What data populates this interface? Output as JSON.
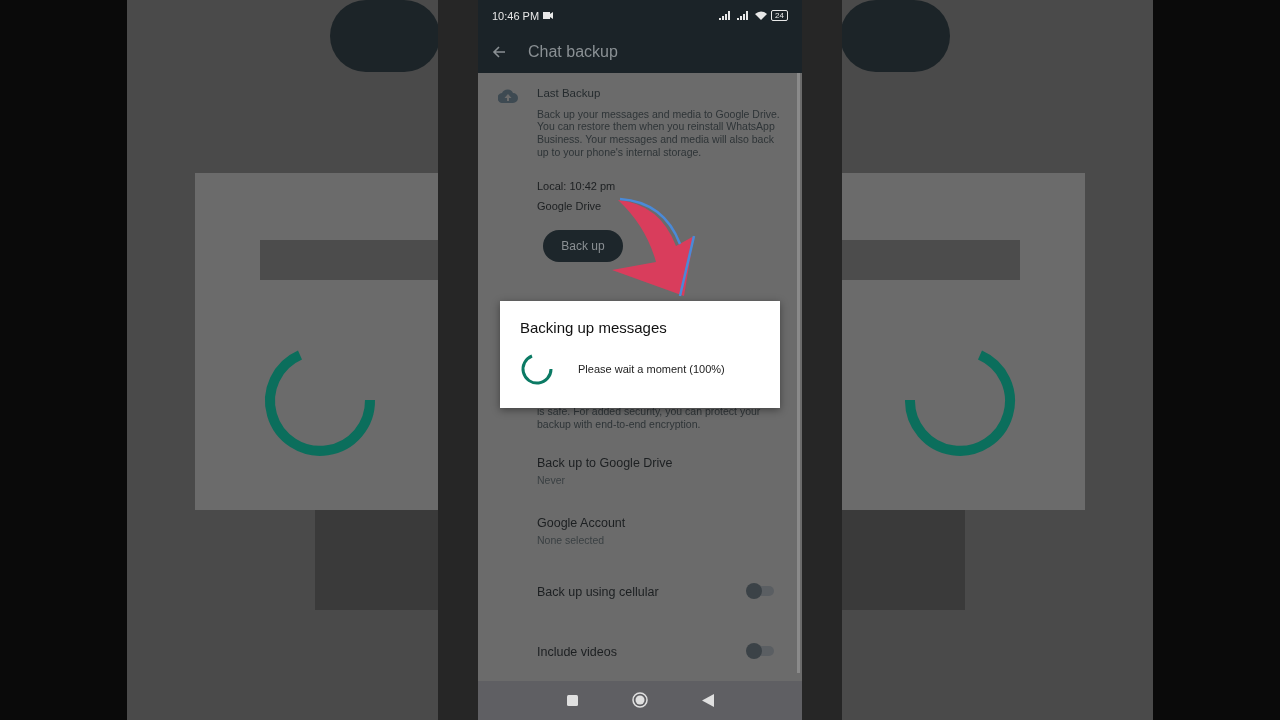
{
  "status_bar": {
    "time": "10:46 PM",
    "battery": "24"
  },
  "app_bar": {
    "title": "Chat backup"
  },
  "last_backup": {
    "title": "Last Backup",
    "description": "Back up your messages and media to Google Drive. You can restore them when you reinstall WhatsApp Business. Your messages and media will also back up to your phone's internal storage.",
    "local": "Local: 10:42 pm",
    "google_drive": "Google Drive",
    "button": "Back up"
  },
  "encryption": {
    "description": "is safe. For added security, you can protect your backup with end-to-end encryption."
  },
  "settings": [
    {
      "kind": "value",
      "title": "Back up to Google Drive",
      "value": "Never"
    },
    {
      "kind": "value",
      "title": "Google Account",
      "value": "None selected"
    },
    {
      "kind": "toggle",
      "title": "Back up using cellular",
      "on": false
    },
    {
      "kind": "toggle",
      "title": "Include videos",
      "on": false
    }
  ],
  "dialog": {
    "title": "Backing up messages",
    "message": "Please wait a moment (100%)"
  }
}
